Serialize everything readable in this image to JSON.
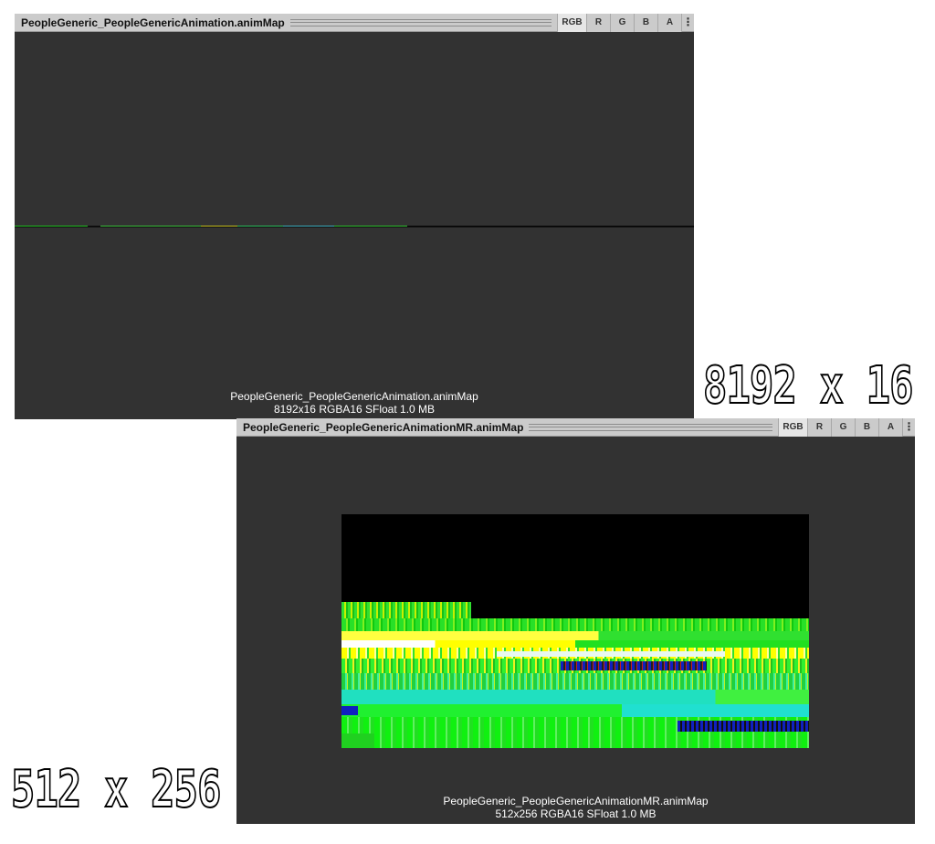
{
  "panels": [
    {
      "title": "PeopleGeneric_PeopleGenericAnimation.animMap",
      "channels": [
        "RGB",
        "R",
        "G",
        "B",
        "A"
      ],
      "menu_icon": "⋮",
      "info_name": "PeopleGeneric_PeopleGenericAnimation.animMap",
      "info_detail": "8192x16  RGBA16 SFloat   1.0 MB"
    },
    {
      "title": "PeopleGeneric_PeopleGenericAnimationMR.animMap",
      "channels": [
        "RGB",
        "R",
        "G",
        "B",
        "A"
      ],
      "menu_icon": "⋮",
      "info_name": "PeopleGeneric_PeopleGenericAnimationMR.animMap",
      "info_detail": "512x256  RGBA16 SFloat   1.0 MB"
    }
  ],
  "labels": {
    "top": "8192 x 16",
    "bottom": "512 x 256"
  },
  "colors": {
    "panel_bg": "#323232",
    "titlebar_bg": "#cbcbcb",
    "tex_green": "#22e022",
    "tex_yellow": "#f4f400",
    "tex_cyan": "#22e0c8",
    "tex_white": "#ffffff",
    "tex_blue": "#1020c0"
  }
}
